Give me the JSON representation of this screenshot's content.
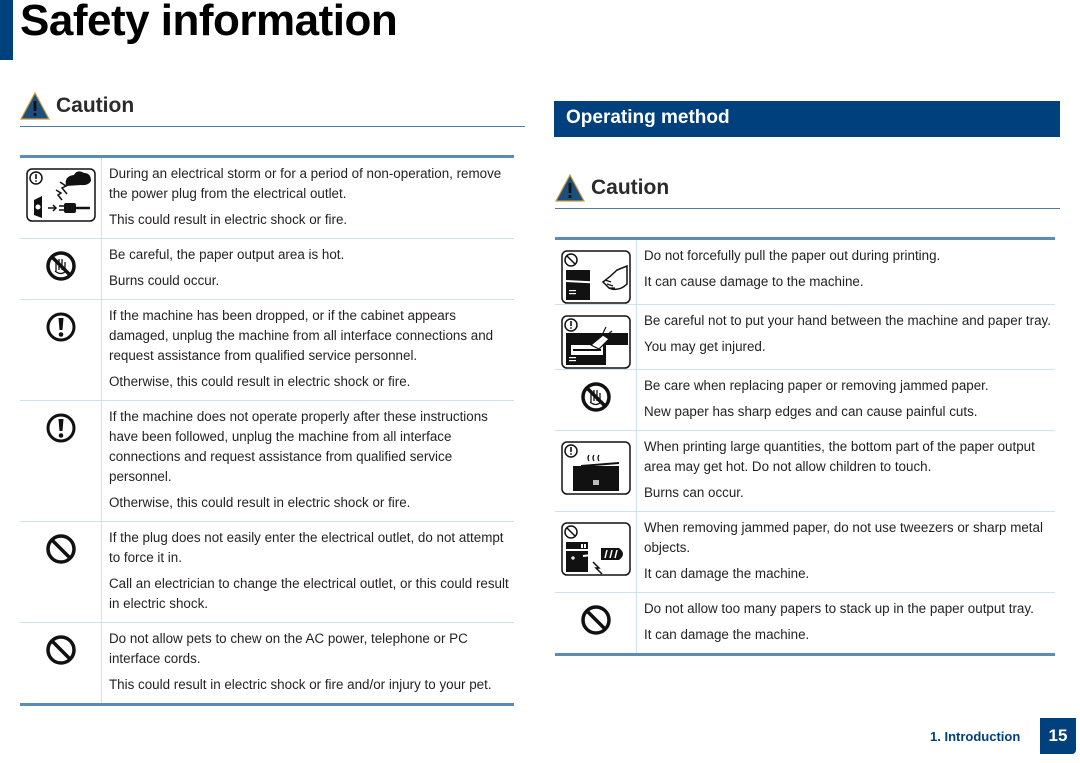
{
  "page": {
    "title": "Safety information",
    "accent_color": "#00407d"
  },
  "left": {
    "caution_label": "Caution",
    "rows": [
      {
        "icon": "storm-unplug-icon",
        "lines": [
          "During an electrical storm or for a period of non-operation, remove the power plug from the electrical outlet.",
          "This could result in electric shock or fire."
        ]
      },
      {
        "icon": "no-touch-hand-icon",
        "lines": [
          "Be careful, the paper output area is hot.",
          "Burns could occur."
        ]
      },
      {
        "icon": "warning-exclamation-icon",
        "lines": [
          "If the machine has been dropped, or if the cabinet appears damaged, unplug the machine from all interface connections and request assistance from qualified service personnel.",
          "Otherwise, this could result in electric shock or fire."
        ]
      },
      {
        "icon": "warning-exclamation-icon",
        "lines": [
          "If the machine does not operate properly after these instructions have been followed, unplug the machine from all interface connections and request assistance from qualified service personnel.",
          "Otherwise, this could result in electric shock or fire."
        ]
      },
      {
        "icon": "prohibited-icon",
        "lines": [
          "If the plug does not easily enter the electrical outlet, do not attempt to force it in.",
          "Call an electrician to change the electrical outlet, or this could result in electric shock."
        ]
      },
      {
        "icon": "prohibited-icon",
        "lines": [
          "Do not allow pets to chew on the AC power, telephone or PC interface cords.",
          "This could result in electric shock or fire and/or injury to your pet."
        ]
      }
    ]
  },
  "right": {
    "section_title": "Operating method",
    "caution_label": "Caution",
    "rows": [
      {
        "icon": "no-pull-paper-icon",
        "lines": [
          "Do not forcefully pull the paper out during printing.",
          "It can cause damage to the machine."
        ]
      },
      {
        "icon": "hand-in-tray-warning-icon",
        "lines": [
          "Be careful not to put your hand between the machine and paper tray.",
          "You may get injured."
        ]
      },
      {
        "icon": "no-touch-hand-icon",
        "lines": [
          "Be care when replacing paper or removing jammed paper.",
          "New paper has sharp edges and can cause painful cuts."
        ]
      },
      {
        "icon": "hot-output-warning-icon",
        "lines": [
          "When printing large quantities, the bottom part of the paper output area may get hot. Do not allow children to touch.",
          "Burns can occur."
        ]
      },
      {
        "icon": "no-tweezers-icon",
        "lines": [
          "When removing jammed paper, do not use tweezers or sharp metal objects.",
          "It can damage the machine."
        ]
      },
      {
        "icon": "prohibited-icon",
        "lines": [
          "Do not allow too many papers to stack up in the paper output tray.",
          "It can damage the machine."
        ]
      }
    ]
  },
  "footer": {
    "chapter": "1. Introduction",
    "page_number": "15"
  }
}
